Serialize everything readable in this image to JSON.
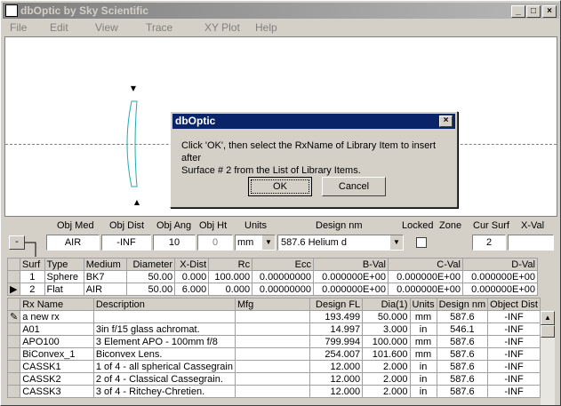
{
  "window": {
    "title": "dbOptic by Sky Scientific"
  },
  "menu": [
    "File",
    "Edit",
    "View",
    "Trace",
    "XY Plot",
    "Help"
  ],
  "dialog": {
    "title": "dbOptic",
    "line1": "Click 'OK', then select the RxName of Library Item to insert after",
    "line2": "Surface # 2 from the List of Library Items.",
    "ok": "OK",
    "cancel": "Cancel"
  },
  "params": {
    "labels": {
      "obj_med": "Obj Med",
      "obj_dist": "Obj Dist",
      "obj_ang": "Obj Ang",
      "obj_ht": "Obj Ht",
      "units": "Units",
      "design": "Design nm",
      "locked": "Locked",
      "zone": "Zone",
      "cur_surf": "Cur Surf",
      "xval": "X-Val"
    },
    "values": {
      "obj_med": "AIR",
      "obj_dist": "-INF",
      "obj_ang": "10",
      "obj_ht": "0",
      "units": "mm",
      "design": "587.6 Helium d",
      "cur_surf": "2",
      "xval": ""
    },
    "minus": "-"
  },
  "surfaces": {
    "headers": [
      "Surf",
      "Type",
      "Medium",
      "Diameter",
      "X-Dist",
      "Rc",
      "Ecc",
      "B-Val",
      "C-Val",
      "D-Val"
    ],
    "rows": [
      [
        "1",
        "Sphere",
        "BK7",
        "50.00",
        "0.000",
        "100.000",
        "0.00000000",
        "0.000000E+00",
        "0.000000E+00",
        "0.000000E+00"
      ],
      [
        "2",
        "Flat",
        "AIR",
        "50.00",
        "6.000",
        "0.000",
        "0.00000000",
        "0.000000E+00",
        "0.000000E+00",
        "0.000000E+00"
      ]
    ]
  },
  "library": {
    "headers": [
      "Rx Name",
      "Description",
      "Mfg",
      "Design FL",
      "Dia(1)",
      "Units",
      "Design nm",
      "Object Dist"
    ],
    "rows": [
      [
        "a new  rx",
        "",
        "",
        "193.499",
        "50.000",
        "mm",
        "587.6",
        "-INF"
      ],
      [
        "A01",
        "3in f/15 glass achromat.",
        "",
        "14.997",
        "3.000",
        "in",
        "546.1",
        "-INF"
      ],
      [
        "APO100",
        "3 Element APO - 100mm f/8",
        "",
        "799.994",
        "100.000",
        "mm",
        "587.6",
        "-INF"
      ],
      [
        "BiConvex_1",
        "Biconvex Lens.",
        "",
        "254.007",
        "101.600",
        "mm",
        "587.6",
        "-INF"
      ],
      [
        "CASSK1",
        "1 of 4 - all spherical Cassegrain",
        "",
        "12.000",
        "2.000",
        "in",
        "587.6",
        "-INF"
      ],
      [
        "CASSK2",
        "2 of 4 - Classical Cassegrain.",
        "",
        "12.000",
        "2.000",
        "in",
        "587.6",
        "-INF"
      ],
      [
        "CASSK3",
        "3 of 4 - Ritchey-Chretien.",
        "",
        "12.000",
        "2.000",
        "in",
        "587.6",
        "-INF"
      ]
    ]
  }
}
